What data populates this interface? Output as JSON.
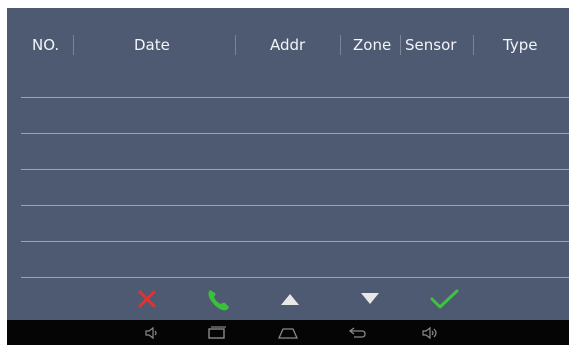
{
  "table": {
    "headers": [
      "NO.",
      "Date",
      "Addr",
      "Zone",
      "Sensor",
      "Type"
    ],
    "rows": []
  },
  "toolbar": {
    "buttons": [
      {
        "name": "delete",
        "icon": "x-icon",
        "color": "#e0322e"
      },
      {
        "name": "call",
        "icon": "phone-icon",
        "color": "#37c23a"
      },
      {
        "name": "up",
        "icon": "triangle-up-icon",
        "color": "#e8e8e8"
      },
      {
        "name": "down",
        "icon": "triangle-down-icon",
        "color": "#e8e8e8"
      },
      {
        "name": "confirm",
        "icon": "checkmark-icon",
        "color": "#3fc23f"
      }
    ]
  },
  "navbar": {
    "buttons": [
      "volume-down-icon",
      "recent-apps-icon",
      "home-icon",
      "back-icon",
      "volume-up-icon"
    ]
  },
  "colors": {
    "background": "#4e5a72",
    "text": "#f2f4f8",
    "navbar": "#050505"
  }
}
